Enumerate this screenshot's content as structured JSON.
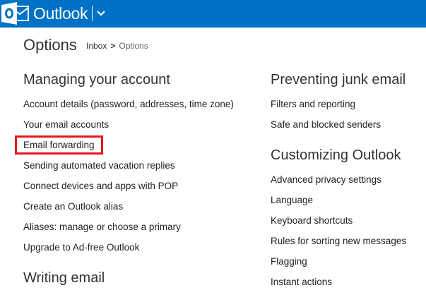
{
  "header": {
    "brand": "Outlook",
    "colors": {
      "bar": "#0072c6",
      "highlight": "#e8141e"
    },
    "logo_icon": "outlook-logo-icon",
    "menu_icon": "chevron-down-icon"
  },
  "page": {
    "title": "Options",
    "breadcrumb": {
      "parent": "Inbox",
      "separator": ">",
      "current": "Options"
    }
  },
  "left": {
    "managing": {
      "heading": "Managing your account",
      "items": [
        "Account details (password, addresses, time zone)",
        "Your email accounts",
        "Email forwarding",
        "Sending automated vacation replies",
        "Connect devices and apps with POP",
        "Create an Outlook alias",
        "Aliases: manage or choose a primary",
        "Upgrade to Ad-free Outlook"
      ]
    },
    "writing": {
      "heading": "Writing email"
    }
  },
  "right": {
    "junk": {
      "heading": "Preventing junk email",
      "items": [
        "Filters and reporting",
        "Safe and blocked senders"
      ]
    },
    "customizing": {
      "heading": "Customizing Outlook",
      "items": [
        "Advanced privacy settings",
        "Language",
        "Keyboard shortcuts",
        "Rules for sorting new messages",
        "Flagging",
        "Instant actions"
      ]
    }
  }
}
